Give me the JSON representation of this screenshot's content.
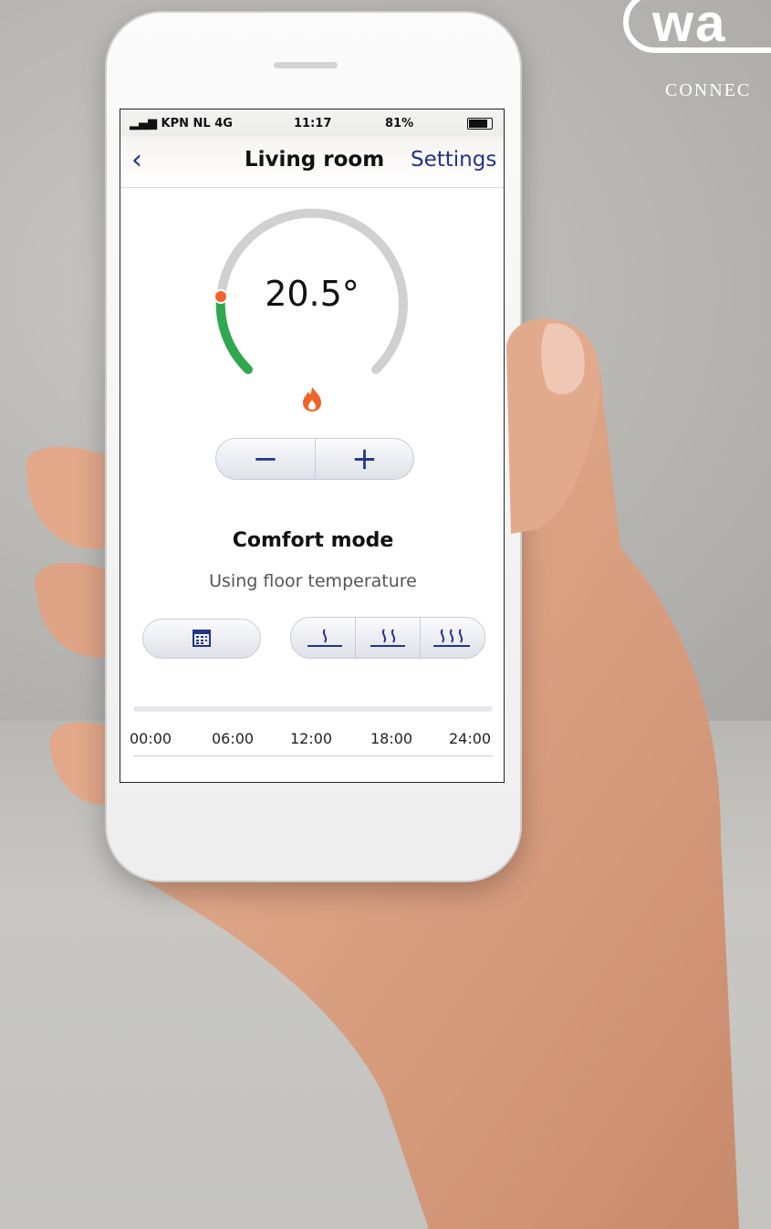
{
  "brand": {
    "logo": "wa",
    "tagline": "CONNEC"
  },
  "status_bar": {
    "carrier": "KPN NL",
    "network": "4G",
    "time": "11:17",
    "battery": "81%"
  },
  "nav": {
    "title": "Living room",
    "settings_label": "Settings"
  },
  "thermostat": {
    "temperature": "20.5°",
    "mode": "Comfort mode",
    "source": "Using floor temperature",
    "decrease_label": "−",
    "increase_label": "+"
  },
  "timeline": {
    "labels": [
      "00:00",
      "06:00",
      "12:00",
      "18:00",
      "24:00"
    ]
  },
  "colors": {
    "accent": "#23348a",
    "heat_green": "#2fa84f",
    "heat_orange": "#f0632a"
  },
  "icons": {
    "back": "chevron-left-icon",
    "heating": "flame-icon",
    "schedule": "calendar-icon",
    "levels": [
      "heat-level-1-icon",
      "heat-level-2-icon",
      "heat-level-3-icon"
    ]
  }
}
